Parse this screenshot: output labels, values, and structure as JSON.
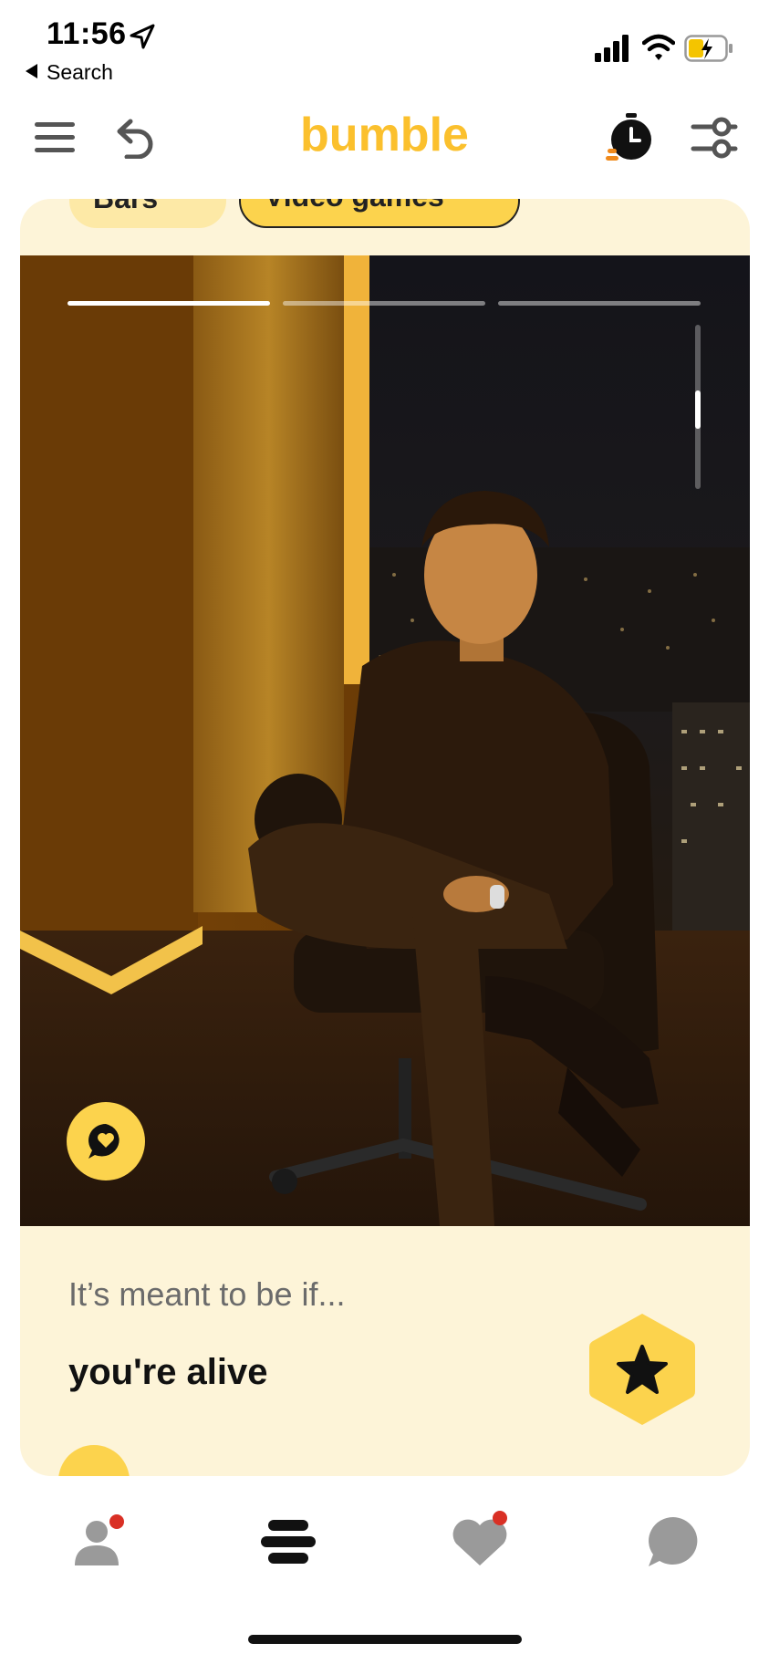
{
  "status_bar": {
    "time": "11:56",
    "back_label": "Search"
  },
  "header": {
    "logo": "bumble"
  },
  "chips": [
    {
      "label": "Bars"
    },
    {
      "label": "Video games"
    }
  ],
  "photo": {
    "index": 1,
    "total": 3
  },
  "prompt": {
    "label": "It’s meant to be if...",
    "answer": "you're alive"
  },
  "colors": {
    "brand": "#fbc02d",
    "card": "#fdf4d8",
    "badge": "#d93025"
  },
  "icons": {
    "header": [
      "menu-icon",
      "undo-icon",
      "timer-icon",
      "filters-icon"
    ],
    "nav": [
      "profile-icon",
      "discover-icon",
      "likes-icon",
      "chat-icon"
    ]
  }
}
